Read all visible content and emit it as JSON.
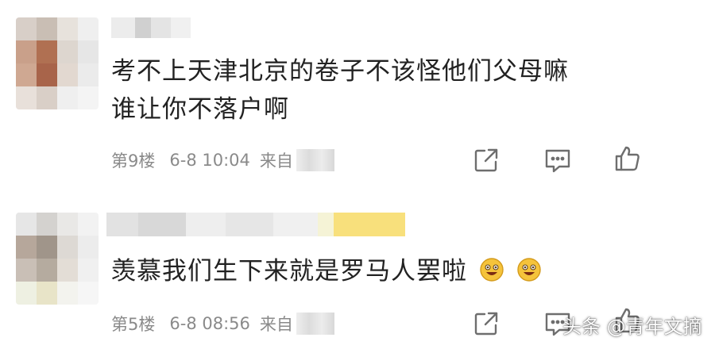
{
  "comments": [
    {
      "text": "考不上天津北京的卷子不该怪他们父母嘛\n谁让你不落户啊",
      "floor": "第9楼",
      "time": "6-8 10:04",
      "source_prefix": "来自"
    },
    {
      "text": "羡慕我们生下来就是罗马人罢啦",
      "floor": "第5楼",
      "time": "6-8 08:56",
      "source_prefix": "来自"
    }
  ],
  "icons": {
    "share": "share-icon",
    "comment": "comment-icon",
    "like": "like-icon",
    "emoji": "grinning-emoji-icon"
  },
  "watermark": "头条 @青年文摘",
  "colors": {
    "text": "#222222",
    "meta": "#8a8a8a",
    "icon": "#6e6e6e",
    "emoji": "#f5c33b"
  }
}
